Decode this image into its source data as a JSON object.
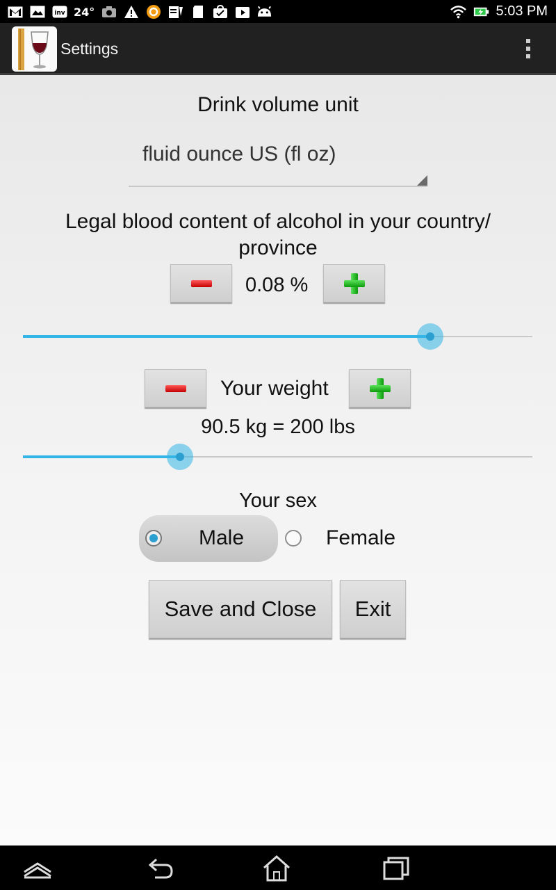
{
  "status_bar": {
    "temperature": "24°",
    "time": "5:03 PM"
  },
  "action_bar": {
    "title": "Settings"
  },
  "settings": {
    "volume_label": "Drink volume unit",
    "volume_selected": "fluid ounce US (fl oz)",
    "legal_bac_label_line1": "Legal blood content of alcohol in your country/",
    "legal_bac_label_line2": "province",
    "legal_bac_value": "0.08 %",
    "legal_bac_slider_fraction": 0.8,
    "weight_label": "Your weight",
    "weight_value": "90.5 kg = 200 lbs",
    "weight_slider_fraction": 0.309,
    "sex_label": "Your sex",
    "sex_options": [
      "Male",
      "Female"
    ],
    "sex_selected": "Male",
    "save_label": "Save and Close",
    "exit_label": "Exit"
  },
  "colors": {
    "accent": "#33b5e5",
    "minus": "#e00000",
    "plus": "#1aa51a"
  }
}
